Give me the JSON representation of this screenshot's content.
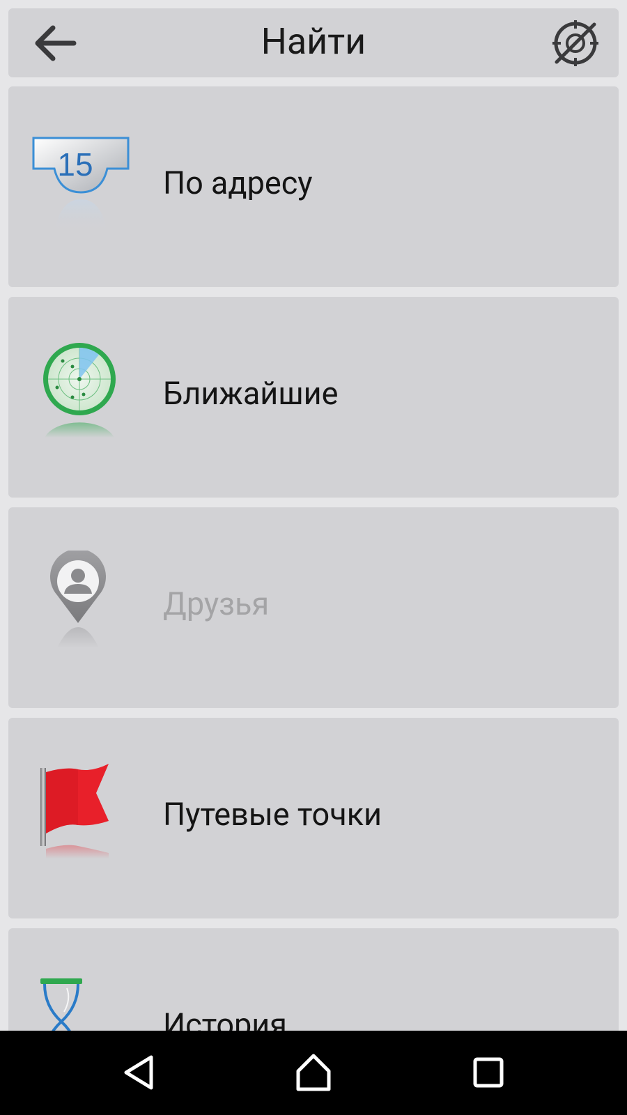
{
  "header": {
    "title": "Найти",
    "back_icon": "arrow-left-icon",
    "gps_icon": "gps-off-icon"
  },
  "menu": {
    "items": [
      {
        "label": "По адресу",
        "icon": "calendar-address-icon",
        "enabled": true,
        "number": "15"
      },
      {
        "label": "Ближайшие",
        "icon": "radar-icon",
        "enabled": true
      },
      {
        "label": "Друзья",
        "icon": "friend-pin-icon",
        "enabled": false
      },
      {
        "label": "Путевые точки",
        "icon": "red-flag-icon",
        "enabled": true
      },
      {
        "label": "История",
        "icon": "hourglass-icon",
        "enabled": true
      }
    ]
  },
  "navbar": {
    "buttons": [
      "back-triangle-icon",
      "home-icon",
      "recents-square-icon"
    ]
  },
  "colors": {
    "background": "#e6e6e8",
    "item_bg": "#d2d2d5",
    "text": "#141414",
    "disabled_text": "#a4a4a6",
    "flag_red": "#e8202a",
    "radar_green": "#2fa84f",
    "calendar_blue": "#2a7bc8"
  }
}
